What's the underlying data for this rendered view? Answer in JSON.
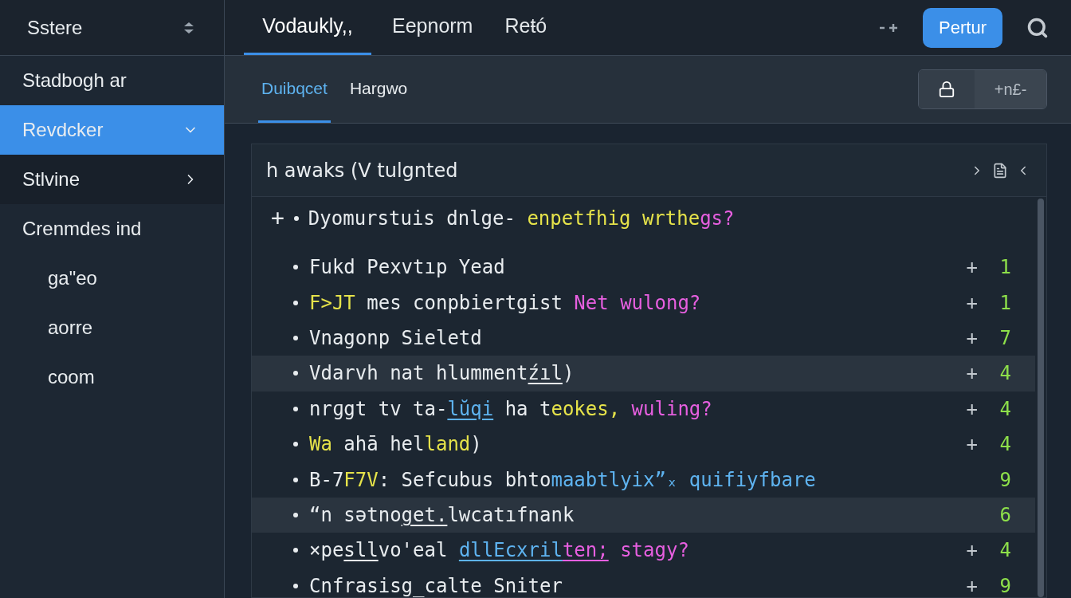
{
  "sidebar": {
    "title": "Sstere",
    "items": [
      {
        "label": "Stadbogh ar",
        "kind": "plain",
        "selected": false
      },
      {
        "label": "Revdcker",
        "kind": "expandable",
        "expanded": true,
        "selected": true
      },
      {
        "label": "Stlvine",
        "kind": "expandable",
        "expanded": false,
        "selected": false
      },
      {
        "label": "Crenmdes ind",
        "kind": "group",
        "selected": false,
        "children": [
          {
            "label": "ga\"eo"
          },
          {
            "label": "aorre"
          },
          {
            "label": "coom"
          }
        ]
      }
    ]
  },
  "tabs": [
    {
      "label": "Vodaukly,,",
      "selected": true
    },
    {
      "label": "Eepnorm",
      "selected": false
    },
    {
      "label": "Reŧó",
      "selected": false
    }
  ],
  "primary_button": "Pertur",
  "subtabs": [
    {
      "label": "Duibqcet",
      "selected": true
    },
    {
      "label": "Hargwo",
      "selected": false
    }
  ],
  "segment_label": "+n£-",
  "panel": {
    "title": "h awaks (V tulgnted",
    "lead": {
      "plus": "+",
      "segments": [
        {
          "text": "Dyomurstuis dnlge- ",
          "color": "#e8ecef"
        },
        {
          "text": "enpetfhig wrthe",
          "color": "#e6e34a"
        },
        {
          "text": "gs?",
          "color": "#e75fe0"
        }
      ]
    },
    "rows": [
      {
        "highlighted": false,
        "plus": "+",
        "count": "1",
        "segments": [
          {
            "text": "Fukd Pexvtıp Yead",
            "color": "#e8ecef"
          }
        ]
      },
      {
        "highlighted": false,
        "plus": "+",
        "count": "1",
        "segments": [
          {
            "text": "F>JT",
            "color": "#e6e34a"
          },
          {
            "text": " mes conpbiertgist ",
            "color": "#e8ecef"
          },
          {
            "text": "Net wulong?",
            "color": "#e75fe0"
          }
        ]
      },
      {
        "highlighted": false,
        "plus": "+",
        "count": "7",
        "segments": [
          {
            "text": "Vnagonp Sieletd",
            "color": "#e8ecef"
          }
        ]
      },
      {
        "highlighted": true,
        "plus": "+",
        "count": "4",
        "segments": [
          {
            "text": "Vdarvh nat hlumment",
            "color": "#e8ecef"
          },
          {
            "text": "źıl",
            "color": "#e8ecef",
            "underline": true
          },
          {
            "text": ")",
            "color": "#e8ecef"
          }
        ]
      },
      {
        "highlighted": false,
        "plus": "+",
        "count": "4",
        "segments": [
          {
            "text": "nrɡgt tv ta-",
            "color": "#e8ecef"
          },
          {
            "text": "lŭqi",
            "color": "#5eb3f0",
            "underline": true
          },
          {
            "text": " ha t",
            "color": "#e8ecef"
          },
          {
            "text": "eokes,",
            "color": "#e6e34a"
          },
          {
            "text": " wuling?",
            "color": "#e75fe0"
          }
        ]
      },
      {
        "highlighted": false,
        "plus": "+",
        "count": "4",
        "segments": [
          {
            "text": "Wa",
            "color": "#e6e34a"
          },
          {
            "text": " ahā hel",
            "color": "#e8ecef"
          },
          {
            "text": "land",
            "color": "#e6e34a"
          },
          {
            "text": ")",
            "color": "#e8ecef"
          }
        ]
      },
      {
        "highlighted": false,
        "count": "9",
        "segments": [
          {
            "text": "B-7",
            "color": "#e8ecef"
          },
          {
            "text": "F7V",
            "color": "#e6e34a"
          },
          {
            "text": ": Sefcubus bhto",
            "color": "#e8ecef"
          },
          {
            "text": "maabtlyix”ₓ quifiyfbare",
            "color": "#5eb3f0"
          }
        ]
      },
      {
        "highlighted": true,
        "count": "6",
        "segments": [
          {
            "text": "“n sǝtno",
            "color": "#e8ecef"
          },
          {
            "text": "get.",
            "color": "#e8ecef",
            "underline": true
          },
          {
            "text": "lwcatıfnank",
            "color": "#e8ecef"
          }
        ]
      },
      {
        "highlighted": false,
        "plus": "+",
        "count": "4",
        "segments": [
          {
            "text": "×pe",
            "color": "#e8ecef"
          },
          {
            "text": "sll",
            "color": "#e8ecef",
            "underline": true
          },
          {
            "text": "vo'eal ",
            "color": "#e8ecef"
          },
          {
            "text": "dllEcxril",
            "color": "#5eb3f0",
            "underline": true
          },
          {
            "text": "ten;",
            "color": "#e75fe0",
            "underline": true
          },
          {
            "text": " stagy?",
            "color": "#e75fe0"
          }
        ]
      },
      {
        "highlighted": false,
        "plus": "+",
        "count": "9",
        "segments": [
          {
            "text": "Cnfrasisg_calte Sniter",
            "color": "#e8ecef"
          }
        ]
      }
    ]
  }
}
